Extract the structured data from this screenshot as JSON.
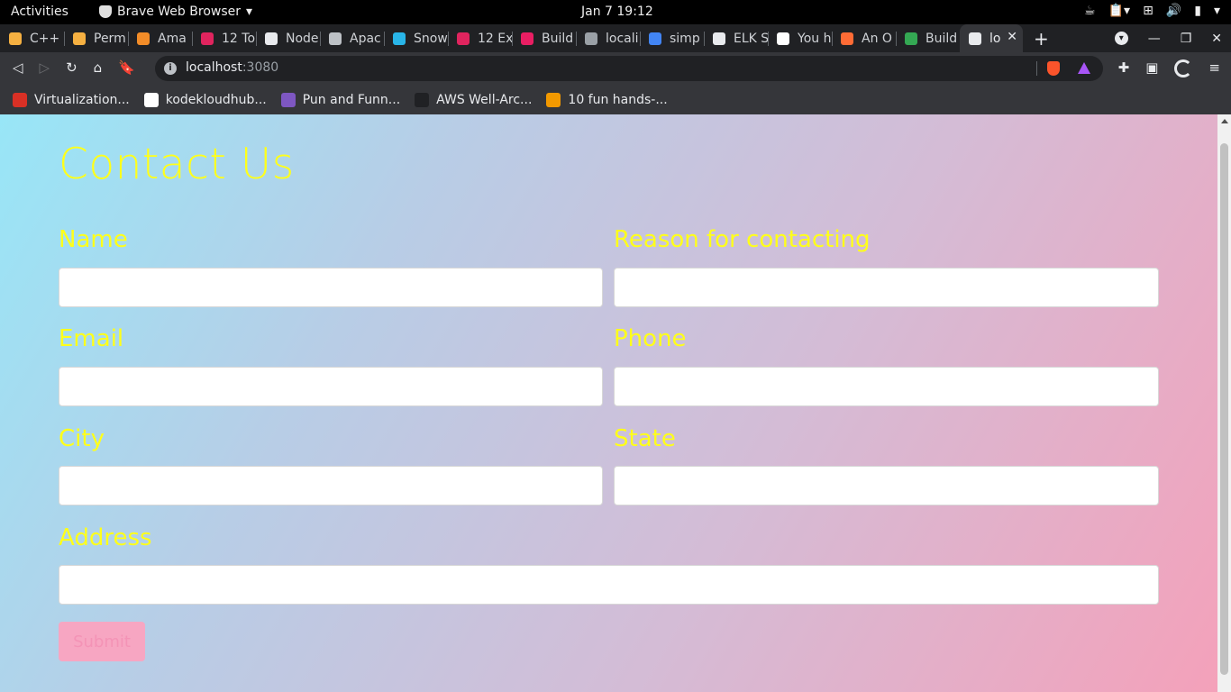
{
  "system": {
    "activities": "Activities",
    "app_name": "Brave Web Browser",
    "clock": "Jan 7  19:12"
  },
  "tabs": [
    {
      "label": "C++ ||",
      "favicon_color": "#f5b041"
    },
    {
      "label": "Perm",
      "favicon_color": "#f5b041"
    },
    {
      "label": "Ama",
      "favicon_color": "#f28c28"
    },
    {
      "label": "12 To",
      "favicon_color": "#e0245e"
    },
    {
      "label": "Node",
      "favicon_color": "#e8eaed"
    },
    {
      "label": "Apac",
      "favicon_color": "#bdc1c6"
    },
    {
      "label": "Snow",
      "favicon_color": "#29b5e8"
    },
    {
      "label": "12 Ex",
      "favicon_color": "#e0245e"
    },
    {
      "label": "Build",
      "favicon_color": "#e91e63"
    },
    {
      "label": "locali",
      "favicon_color": "#9aa0a6"
    },
    {
      "label": "simp",
      "favicon_color": "#4285f4"
    },
    {
      "label": "ELK S",
      "favicon_color": "#e8eaed"
    },
    {
      "label": "You h",
      "favicon_color": "#ffffff"
    },
    {
      "label": "An O",
      "favicon_color": "#ff6b35"
    },
    {
      "label": "Build",
      "favicon_color": "#34a853"
    },
    {
      "label": "lo",
      "favicon_color": "#e8eaed",
      "active": true
    }
  ],
  "toolbar": {
    "url_host": "localhost",
    "url_port": ":3080"
  },
  "bookmarks": [
    {
      "label": "Virtualization...",
      "icon_color": "#d93025"
    },
    {
      "label": "kodekloudhub...",
      "icon_color": "#ffffff"
    },
    {
      "label": "Pun and Funn...",
      "icon_color": "#7e57c2"
    },
    {
      "label": "AWS Well-Arc...",
      "icon_color": "#202124"
    },
    {
      "label": "10 fun hands-...",
      "icon_color": "#f29900"
    }
  ],
  "page": {
    "title": "Contact Us",
    "fields": {
      "name": {
        "label": "Name",
        "value": ""
      },
      "reason": {
        "label": "Reason for contacting",
        "value": ""
      },
      "email": {
        "label": "Email",
        "value": ""
      },
      "phone": {
        "label": "Phone",
        "value": ""
      },
      "city": {
        "label": "City",
        "value": ""
      },
      "state": {
        "label": "State",
        "value": ""
      },
      "address": {
        "label": "Address",
        "value": ""
      }
    },
    "submit_label": "Submit"
  },
  "colors": {
    "label_yellow": "#ffff1a",
    "gradient_start": "#98e6f7",
    "gradient_end": "#f4a1ba",
    "submit_bg": "#f7a6c2"
  }
}
